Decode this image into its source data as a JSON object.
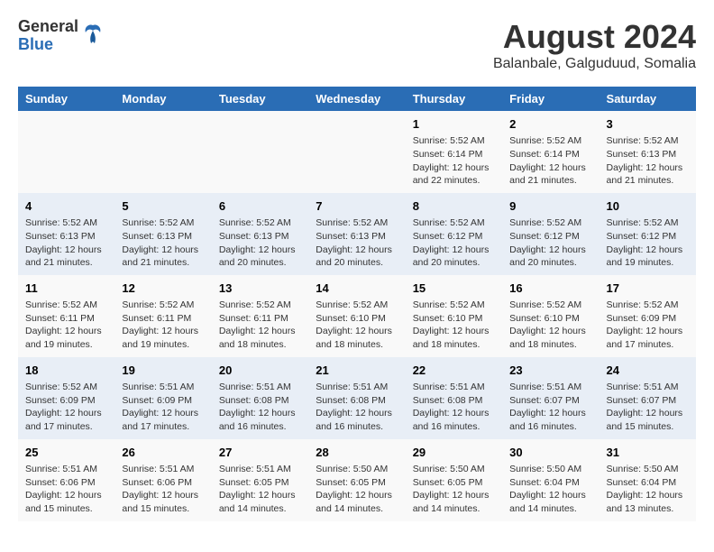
{
  "logo": {
    "general": "General",
    "blue": "Blue"
  },
  "title": "August 2024",
  "subtitle": "Balanbale, Galguduud, Somalia",
  "days_header": [
    "Sunday",
    "Monday",
    "Tuesday",
    "Wednesday",
    "Thursday",
    "Friday",
    "Saturday"
  ],
  "weeks": [
    [
      {
        "num": "",
        "info": ""
      },
      {
        "num": "",
        "info": ""
      },
      {
        "num": "",
        "info": ""
      },
      {
        "num": "",
        "info": ""
      },
      {
        "num": "1",
        "info": "Sunrise: 5:52 AM\nSunset: 6:14 PM\nDaylight: 12 hours\nand 22 minutes."
      },
      {
        "num": "2",
        "info": "Sunrise: 5:52 AM\nSunset: 6:14 PM\nDaylight: 12 hours\nand 21 minutes."
      },
      {
        "num": "3",
        "info": "Sunrise: 5:52 AM\nSunset: 6:13 PM\nDaylight: 12 hours\nand 21 minutes."
      }
    ],
    [
      {
        "num": "4",
        "info": "Sunrise: 5:52 AM\nSunset: 6:13 PM\nDaylight: 12 hours\nand 21 minutes."
      },
      {
        "num": "5",
        "info": "Sunrise: 5:52 AM\nSunset: 6:13 PM\nDaylight: 12 hours\nand 21 minutes."
      },
      {
        "num": "6",
        "info": "Sunrise: 5:52 AM\nSunset: 6:13 PM\nDaylight: 12 hours\nand 20 minutes."
      },
      {
        "num": "7",
        "info": "Sunrise: 5:52 AM\nSunset: 6:13 PM\nDaylight: 12 hours\nand 20 minutes."
      },
      {
        "num": "8",
        "info": "Sunrise: 5:52 AM\nSunset: 6:12 PM\nDaylight: 12 hours\nand 20 minutes."
      },
      {
        "num": "9",
        "info": "Sunrise: 5:52 AM\nSunset: 6:12 PM\nDaylight: 12 hours\nand 20 minutes."
      },
      {
        "num": "10",
        "info": "Sunrise: 5:52 AM\nSunset: 6:12 PM\nDaylight: 12 hours\nand 19 minutes."
      }
    ],
    [
      {
        "num": "11",
        "info": "Sunrise: 5:52 AM\nSunset: 6:11 PM\nDaylight: 12 hours\nand 19 minutes."
      },
      {
        "num": "12",
        "info": "Sunrise: 5:52 AM\nSunset: 6:11 PM\nDaylight: 12 hours\nand 19 minutes."
      },
      {
        "num": "13",
        "info": "Sunrise: 5:52 AM\nSunset: 6:11 PM\nDaylight: 12 hours\nand 18 minutes."
      },
      {
        "num": "14",
        "info": "Sunrise: 5:52 AM\nSunset: 6:10 PM\nDaylight: 12 hours\nand 18 minutes."
      },
      {
        "num": "15",
        "info": "Sunrise: 5:52 AM\nSunset: 6:10 PM\nDaylight: 12 hours\nand 18 minutes."
      },
      {
        "num": "16",
        "info": "Sunrise: 5:52 AM\nSunset: 6:10 PM\nDaylight: 12 hours\nand 18 minutes."
      },
      {
        "num": "17",
        "info": "Sunrise: 5:52 AM\nSunset: 6:09 PM\nDaylight: 12 hours\nand 17 minutes."
      }
    ],
    [
      {
        "num": "18",
        "info": "Sunrise: 5:52 AM\nSunset: 6:09 PM\nDaylight: 12 hours\nand 17 minutes."
      },
      {
        "num": "19",
        "info": "Sunrise: 5:51 AM\nSunset: 6:09 PM\nDaylight: 12 hours\nand 17 minutes."
      },
      {
        "num": "20",
        "info": "Sunrise: 5:51 AM\nSunset: 6:08 PM\nDaylight: 12 hours\nand 16 minutes."
      },
      {
        "num": "21",
        "info": "Sunrise: 5:51 AM\nSunset: 6:08 PM\nDaylight: 12 hours\nand 16 minutes."
      },
      {
        "num": "22",
        "info": "Sunrise: 5:51 AM\nSunset: 6:08 PM\nDaylight: 12 hours\nand 16 minutes."
      },
      {
        "num": "23",
        "info": "Sunrise: 5:51 AM\nSunset: 6:07 PM\nDaylight: 12 hours\nand 16 minutes."
      },
      {
        "num": "24",
        "info": "Sunrise: 5:51 AM\nSunset: 6:07 PM\nDaylight: 12 hours\nand 15 minutes."
      }
    ],
    [
      {
        "num": "25",
        "info": "Sunrise: 5:51 AM\nSunset: 6:06 PM\nDaylight: 12 hours\nand 15 minutes."
      },
      {
        "num": "26",
        "info": "Sunrise: 5:51 AM\nSunset: 6:06 PM\nDaylight: 12 hours\nand 15 minutes."
      },
      {
        "num": "27",
        "info": "Sunrise: 5:51 AM\nSunset: 6:05 PM\nDaylight: 12 hours\nand 14 minutes."
      },
      {
        "num": "28",
        "info": "Sunrise: 5:50 AM\nSunset: 6:05 PM\nDaylight: 12 hours\nand 14 minutes."
      },
      {
        "num": "29",
        "info": "Sunrise: 5:50 AM\nSunset: 6:05 PM\nDaylight: 12 hours\nand 14 minutes."
      },
      {
        "num": "30",
        "info": "Sunrise: 5:50 AM\nSunset: 6:04 PM\nDaylight: 12 hours\nand 14 minutes."
      },
      {
        "num": "31",
        "info": "Sunrise: 5:50 AM\nSunset: 6:04 PM\nDaylight: 12 hours\nand 13 minutes."
      }
    ]
  ]
}
